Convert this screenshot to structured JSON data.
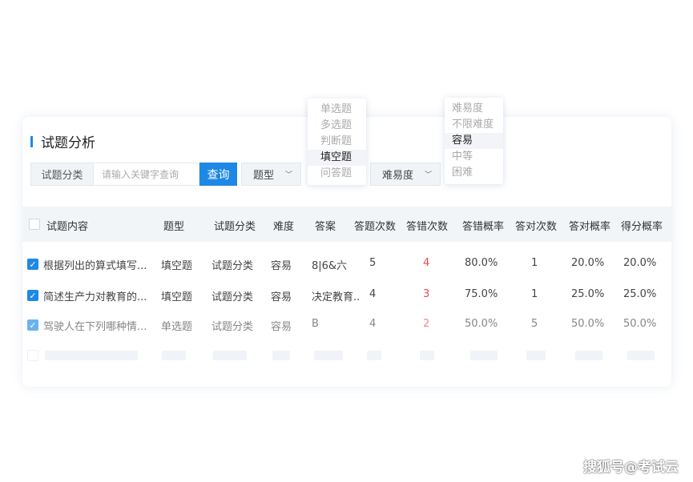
{
  "section": {
    "title": "试题分析"
  },
  "search": {
    "category_label": "试题分类",
    "placeholder": "请输入关键字查询",
    "query_button": "查询",
    "type_select": "题型",
    "difficulty_select": "难易度"
  },
  "type_dropdown": [
    "单选题",
    "多选题",
    "判断题",
    "填空题",
    "问答题"
  ],
  "type_dropdown_selected": "填空题",
  "difficulty_dropdown": [
    "难易度",
    "不限难度",
    "容易",
    "中等",
    "困难"
  ],
  "difficulty_dropdown_selected": "容易",
  "table": {
    "columns": [
      "试题内容",
      "题型",
      "试题分类",
      "难度",
      "答案",
      "答题次数",
      "答错次数",
      "答错概率",
      "答对次数",
      "答对概率",
      "得分概率"
    ],
    "rows": [
      {
        "checked": true,
        "content": "根据列出的算式填写...",
        "type": "填空题",
        "category": "试题分类",
        "difficulty": "容易",
        "answer": "8|6&六",
        "attempts": "5",
        "wrong": "4",
        "wrong_rate": "80.0%",
        "right": "1",
        "right_rate": "20.0%",
        "score_rate": "20.0%"
      },
      {
        "checked": true,
        "content": "简述生产力对教育的...",
        "type": "填空题",
        "category": "试题分类",
        "difficulty": "容易",
        "answer": "决定教育..",
        "attempts": "4",
        "wrong": "3",
        "wrong_rate": "75.0%",
        "right": "1",
        "right_rate": "25.0%",
        "score_rate": "25.0%"
      },
      {
        "checked": true,
        "content": "驾驶人在下列哪种情...",
        "type": "单选题",
        "category": "试题分类",
        "difficulty": "容易",
        "answer": "B",
        "attempts": "4",
        "wrong": "2",
        "wrong_rate": "50.0%",
        "right": "5",
        "right_rate": "50.0%",
        "score_rate": "50.0%"
      }
    ]
  },
  "watermark": "搜狐号@考试云",
  "colors": {
    "accent": "#1e88e5",
    "error": "#e84855"
  }
}
